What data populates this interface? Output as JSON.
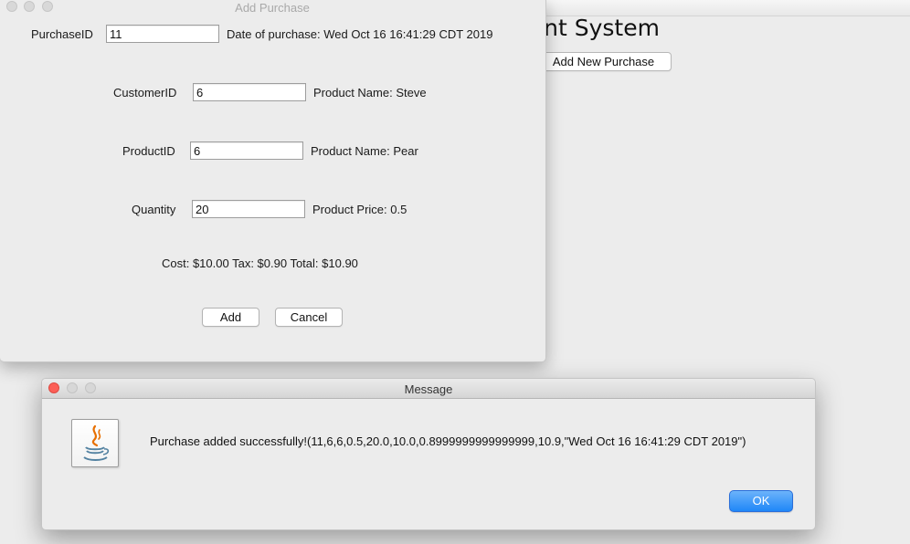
{
  "main_window": {
    "title_partial": "ement System",
    "add_new_purchase_label": "Add New Purchase"
  },
  "add_purchase_dialog": {
    "title": "Add Purchase",
    "purchase_id_label": "PurchaseID",
    "purchase_id_value": "11",
    "date_text": "Date of purchase: Wed Oct 16 16:41:29 CDT 2019",
    "customer_id_label": "CustomerID",
    "customer_id_value": "6",
    "customer_name_text": "Product Name: Steve",
    "product_id_label": "ProductID",
    "product_id_value": "6",
    "product_name_text": "Product Name: Pear",
    "quantity_label": "Quantity",
    "quantity_value": "20",
    "product_price_text": "Product Price: 0.5",
    "totals_text": "Cost: $10.00 Tax: $0.90 Total: $10.90",
    "add_label": "Add",
    "cancel_label": "Cancel"
  },
  "message_dialog": {
    "title": "Message",
    "icon": "java-icon",
    "message": "Purchase added successfully!(11,6,6,0.5,20.0,10.0,0.8999999999999999,10.9,\"Wed Oct 16 16:41:29 CDT 2019\")",
    "ok_label": "OK",
    "accent_color": "#1f87f8"
  }
}
